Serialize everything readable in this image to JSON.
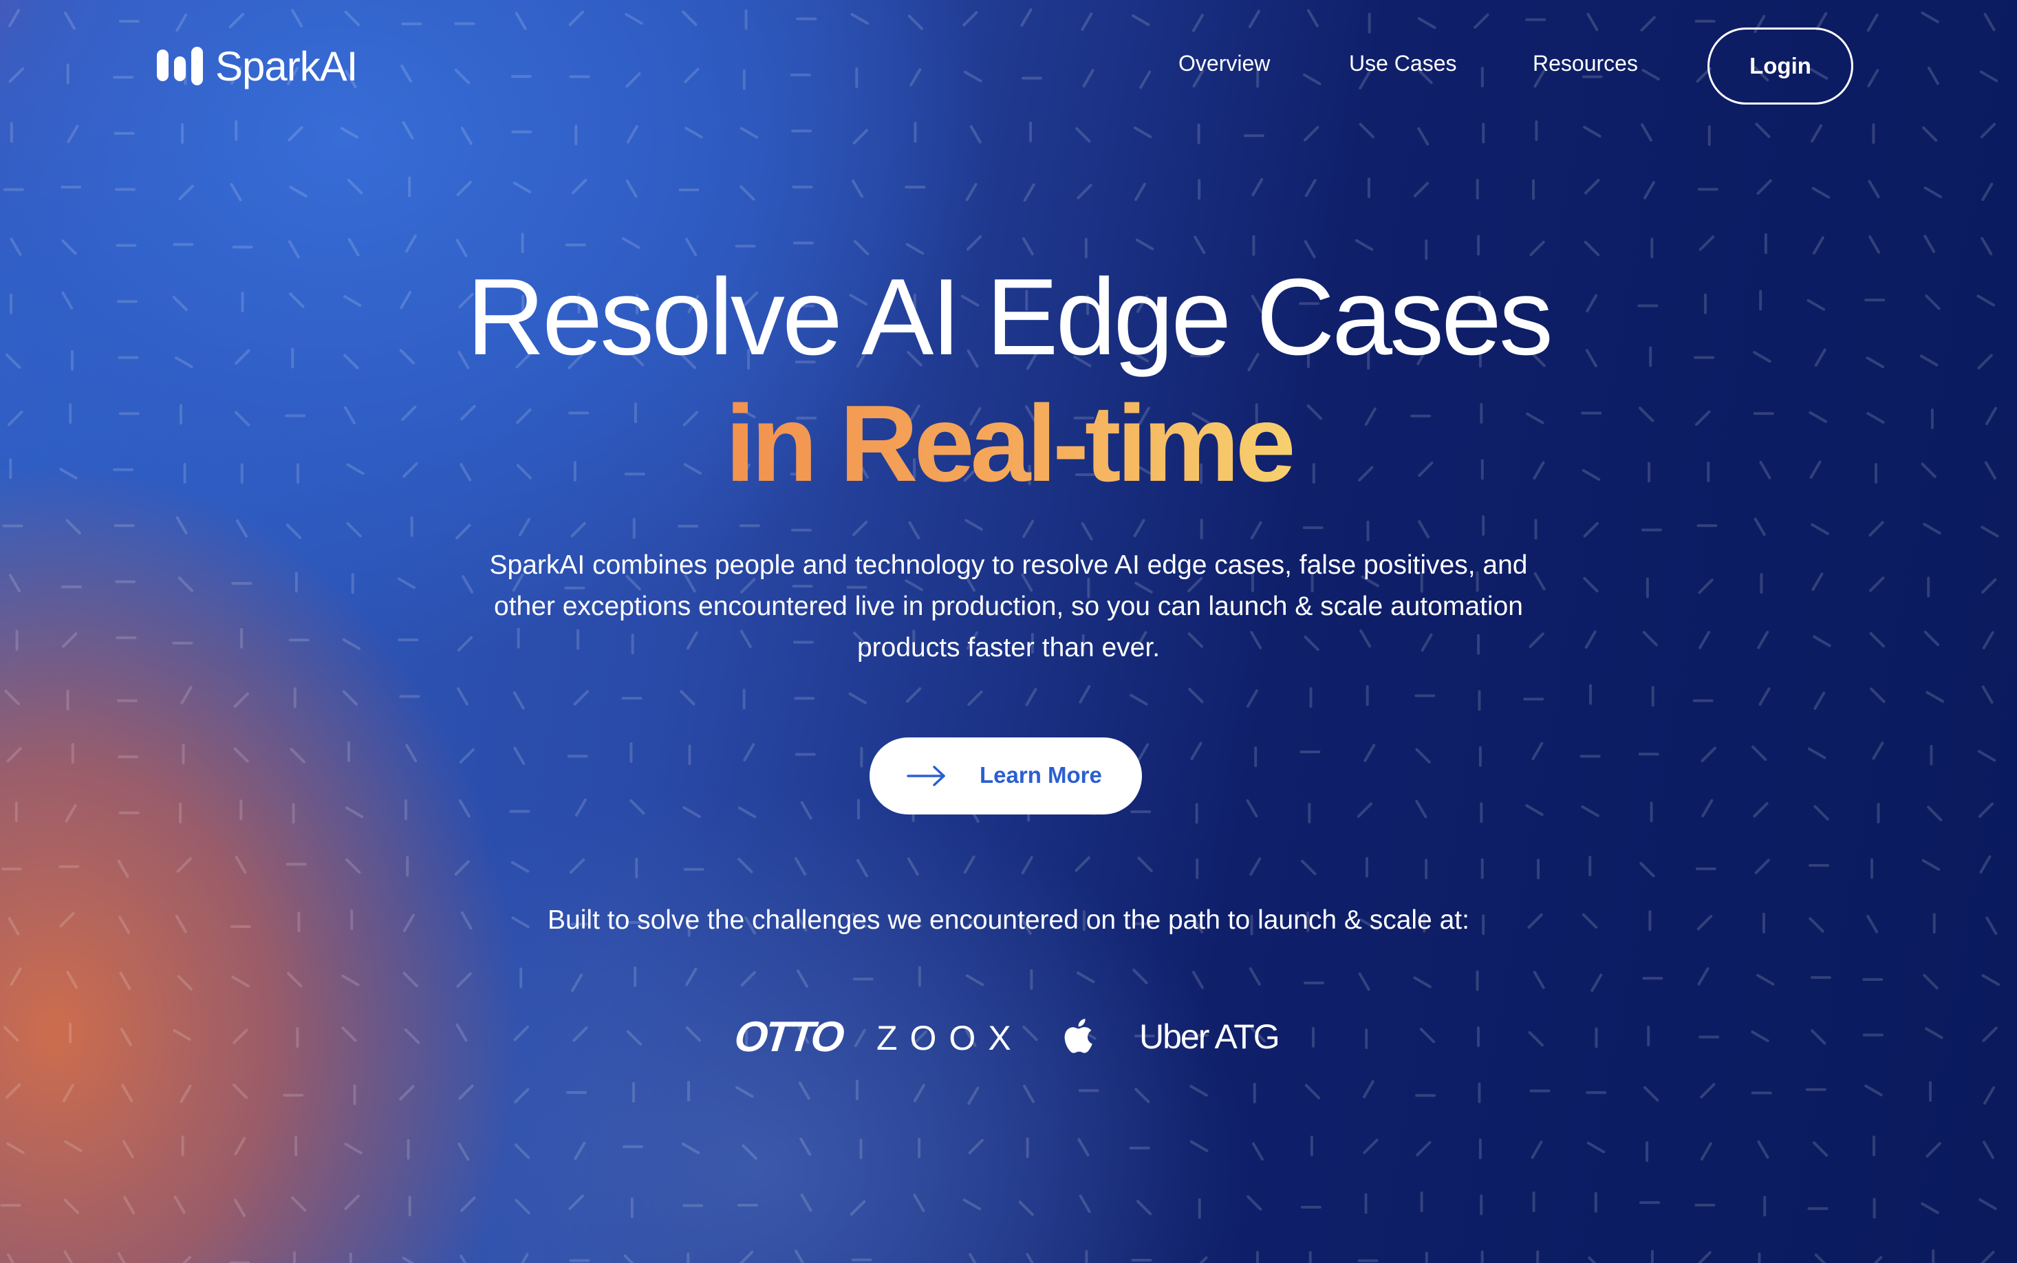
{
  "brand": {
    "name": "SparkAI",
    "logo_icon": "sparkai-bars-icon"
  },
  "nav": {
    "links": [
      {
        "label": "Overview"
      },
      {
        "label": "Use Cases"
      },
      {
        "label": "Resources"
      }
    ],
    "login_label": "Login"
  },
  "hero": {
    "headline_line1": "Resolve AI Edge Cases",
    "headline_line2": "in Real-time",
    "subtitle_lines": [
      "SparkAI combines people and technology to resolve AI edge cases, false positives, and",
      "other exceptions encountered live in production, so you can launch & scale automation",
      "products faster than ever."
    ],
    "cta_label": "Learn More",
    "cta_icon": "arrow-right-icon",
    "built_text": "Built to solve the challenges we encountered on the path to launch & scale at:"
  },
  "customers": [
    {
      "name": "OTTO"
    },
    {
      "name": "ZOOX"
    },
    {
      "name": "Apple",
      "icon": "apple-icon"
    },
    {
      "name": "Uber ATG"
    }
  ],
  "colors": {
    "accent_orange": "#f2924f",
    "accent_yellow": "#f7d06e",
    "cta_text": "#2b5fd1",
    "bg_dark": "#0a1a5c",
    "bg_blue": "#2f5fc4",
    "bg_orange": "#d66e48"
  }
}
